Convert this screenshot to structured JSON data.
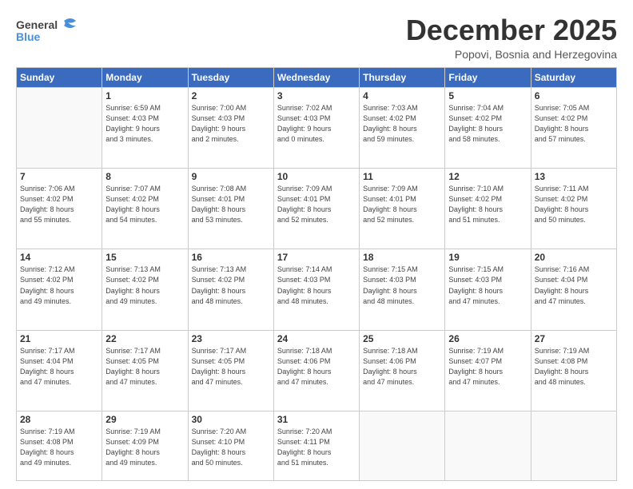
{
  "header": {
    "logo_general": "General",
    "logo_blue": "Blue",
    "month": "December 2025",
    "location": "Popovi, Bosnia and Herzegovina"
  },
  "days_of_week": [
    "Sunday",
    "Monday",
    "Tuesday",
    "Wednesday",
    "Thursday",
    "Friday",
    "Saturday"
  ],
  "weeks": [
    [
      {
        "day": "",
        "info": ""
      },
      {
        "day": "1",
        "info": "Sunrise: 6:59 AM\nSunset: 4:03 PM\nDaylight: 9 hours\nand 3 minutes."
      },
      {
        "day": "2",
        "info": "Sunrise: 7:00 AM\nSunset: 4:03 PM\nDaylight: 9 hours\nand 2 minutes."
      },
      {
        "day": "3",
        "info": "Sunrise: 7:02 AM\nSunset: 4:03 PM\nDaylight: 9 hours\nand 0 minutes."
      },
      {
        "day": "4",
        "info": "Sunrise: 7:03 AM\nSunset: 4:02 PM\nDaylight: 8 hours\nand 59 minutes."
      },
      {
        "day": "5",
        "info": "Sunrise: 7:04 AM\nSunset: 4:02 PM\nDaylight: 8 hours\nand 58 minutes."
      },
      {
        "day": "6",
        "info": "Sunrise: 7:05 AM\nSunset: 4:02 PM\nDaylight: 8 hours\nand 57 minutes."
      }
    ],
    [
      {
        "day": "7",
        "info": "Sunrise: 7:06 AM\nSunset: 4:02 PM\nDaylight: 8 hours\nand 55 minutes."
      },
      {
        "day": "8",
        "info": "Sunrise: 7:07 AM\nSunset: 4:02 PM\nDaylight: 8 hours\nand 54 minutes."
      },
      {
        "day": "9",
        "info": "Sunrise: 7:08 AM\nSunset: 4:01 PM\nDaylight: 8 hours\nand 53 minutes."
      },
      {
        "day": "10",
        "info": "Sunrise: 7:09 AM\nSunset: 4:01 PM\nDaylight: 8 hours\nand 52 minutes."
      },
      {
        "day": "11",
        "info": "Sunrise: 7:09 AM\nSunset: 4:01 PM\nDaylight: 8 hours\nand 52 minutes."
      },
      {
        "day": "12",
        "info": "Sunrise: 7:10 AM\nSunset: 4:02 PM\nDaylight: 8 hours\nand 51 minutes."
      },
      {
        "day": "13",
        "info": "Sunrise: 7:11 AM\nSunset: 4:02 PM\nDaylight: 8 hours\nand 50 minutes."
      }
    ],
    [
      {
        "day": "14",
        "info": "Sunrise: 7:12 AM\nSunset: 4:02 PM\nDaylight: 8 hours\nand 49 minutes."
      },
      {
        "day": "15",
        "info": "Sunrise: 7:13 AM\nSunset: 4:02 PM\nDaylight: 8 hours\nand 49 minutes."
      },
      {
        "day": "16",
        "info": "Sunrise: 7:13 AM\nSunset: 4:02 PM\nDaylight: 8 hours\nand 48 minutes."
      },
      {
        "day": "17",
        "info": "Sunrise: 7:14 AM\nSunset: 4:03 PM\nDaylight: 8 hours\nand 48 minutes."
      },
      {
        "day": "18",
        "info": "Sunrise: 7:15 AM\nSunset: 4:03 PM\nDaylight: 8 hours\nand 48 minutes."
      },
      {
        "day": "19",
        "info": "Sunrise: 7:15 AM\nSunset: 4:03 PM\nDaylight: 8 hours\nand 47 minutes."
      },
      {
        "day": "20",
        "info": "Sunrise: 7:16 AM\nSunset: 4:04 PM\nDaylight: 8 hours\nand 47 minutes."
      }
    ],
    [
      {
        "day": "21",
        "info": "Sunrise: 7:17 AM\nSunset: 4:04 PM\nDaylight: 8 hours\nand 47 minutes."
      },
      {
        "day": "22",
        "info": "Sunrise: 7:17 AM\nSunset: 4:05 PM\nDaylight: 8 hours\nand 47 minutes."
      },
      {
        "day": "23",
        "info": "Sunrise: 7:17 AM\nSunset: 4:05 PM\nDaylight: 8 hours\nand 47 minutes."
      },
      {
        "day": "24",
        "info": "Sunrise: 7:18 AM\nSunset: 4:06 PM\nDaylight: 8 hours\nand 47 minutes."
      },
      {
        "day": "25",
        "info": "Sunrise: 7:18 AM\nSunset: 4:06 PM\nDaylight: 8 hours\nand 47 minutes."
      },
      {
        "day": "26",
        "info": "Sunrise: 7:19 AM\nSunset: 4:07 PM\nDaylight: 8 hours\nand 47 minutes."
      },
      {
        "day": "27",
        "info": "Sunrise: 7:19 AM\nSunset: 4:08 PM\nDaylight: 8 hours\nand 48 minutes."
      }
    ],
    [
      {
        "day": "28",
        "info": "Sunrise: 7:19 AM\nSunset: 4:08 PM\nDaylight: 8 hours\nand 49 minutes."
      },
      {
        "day": "29",
        "info": "Sunrise: 7:19 AM\nSunset: 4:09 PM\nDaylight: 8 hours\nand 49 minutes."
      },
      {
        "day": "30",
        "info": "Sunrise: 7:20 AM\nSunset: 4:10 PM\nDaylight: 8 hours\nand 50 minutes."
      },
      {
        "day": "31",
        "info": "Sunrise: 7:20 AM\nSunset: 4:11 PM\nDaylight: 8 hours\nand 51 minutes."
      },
      {
        "day": "",
        "info": ""
      },
      {
        "day": "",
        "info": ""
      },
      {
        "day": "",
        "info": ""
      }
    ]
  ]
}
